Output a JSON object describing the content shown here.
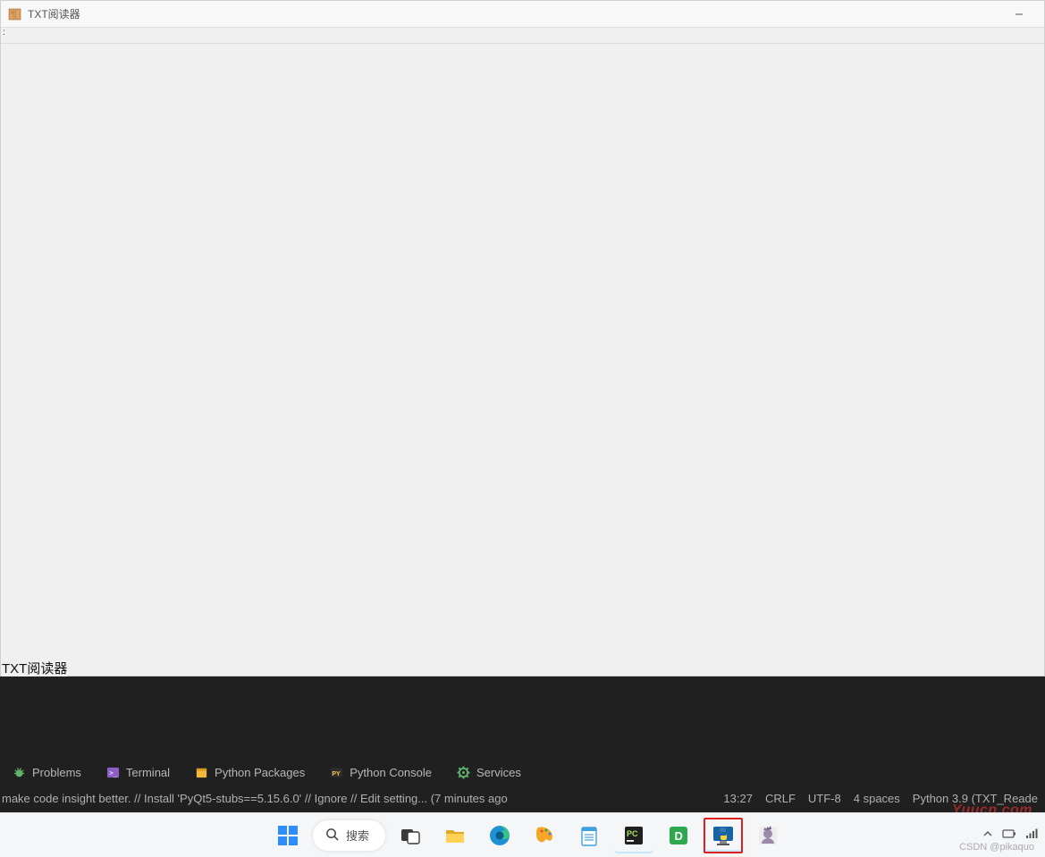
{
  "window": {
    "title": "TXT阅读器",
    "toolbar_hint": ":",
    "status_label": "TXT阅读器"
  },
  "ide": {
    "panels": [
      {
        "name": "problems",
        "label": "Problems",
        "icon": "bug"
      },
      {
        "name": "terminal",
        "label": "Terminal",
        "icon": "terminal"
      },
      {
        "name": "python-packages",
        "label": "Python Packages",
        "icon": "package"
      },
      {
        "name": "python-console",
        "label": "Python Console",
        "icon": "pyconsole"
      },
      {
        "name": "services",
        "label": "Services",
        "icon": "gear"
      }
    ],
    "status": {
      "message": "make code insight better. // Install 'PyQt5-stubs==5.15.6.0' // Ignore // Edit setting... (7 minutes ago",
      "cursor": "13:27",
      "eol": "CRLF",
      "encoding": "UTF-8",
      "indent": "4 spaces",
      "interpreter": "Python 3.9 (TXT_Reade"
    }
  },
  "taskbar": {
    "search_placeholder": "搜索",
    "items": [
      {
        "name": "start",
        "icon": "windows"
      },
      {
        "name": "search",
        "icon": "search-pill"
      },
      {
        "name": "task-view",
        "icon": "taskview"
      },
      {
        "name": "file-explorer",
        "icon": "folder"
      },
      {
        "name": "edge",
        "icon": "edge"
      },
      {
        "name": "paint-app",
        "icon": "paintsplash"
      },
      {
        "name": "notepad",
        "icon": "notepad"
      },
      {
        "name": "pycharm",
        "icon": "pycharm"
      },
      {
        "name": "excel-app",
        "icon": "greenD"
      },
      {
        "name": "python-app",
        "icon": "pythonwin",
        "highlight": true
      },
      {
        "name": "discord-app",
        "icon": "avatar"
      }
    ],
    "tray": {
      "chevron": "^",
      "battery": "bat",
      "more": "..."
    }
  },
  "watermarks": {
    "site": "Yuucn.com",
    "csdn": "CSDN @pikaquo"
  }
}
